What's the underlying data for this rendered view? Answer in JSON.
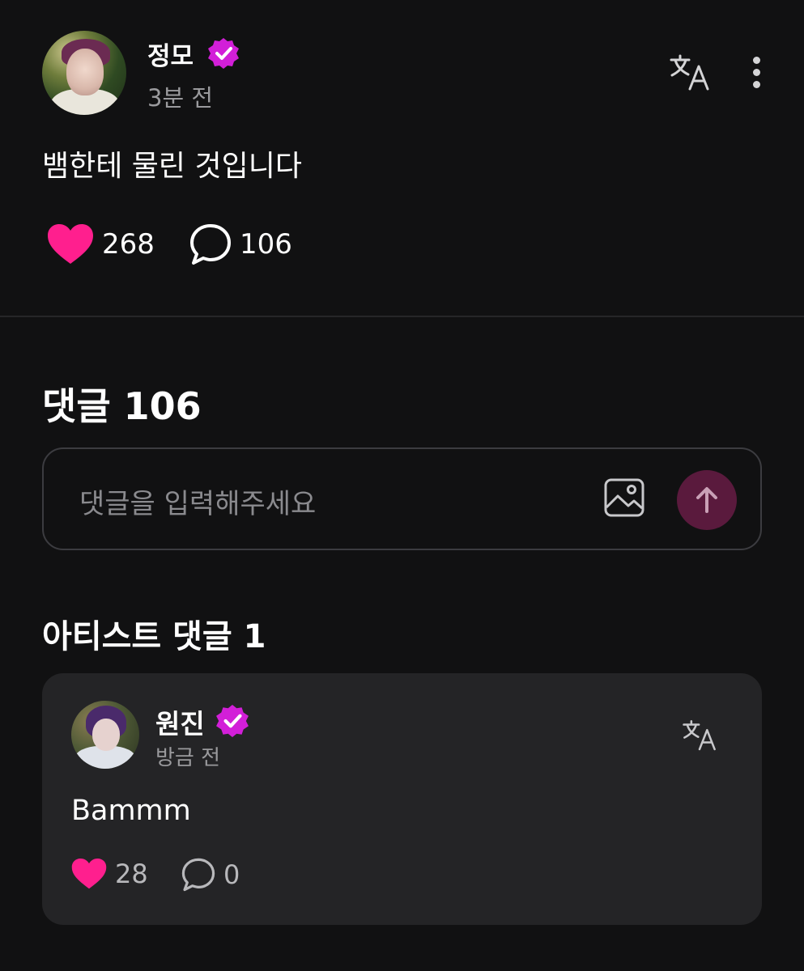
{
  "post": {
    "author": "정모",
    "time": "3분 전",
    "body": "뱀한테 물린 것입니다",
    "likes": "268",
    "comments": "106"
  },
  "comments_section": {
    "title": "댓글 106",
    "input_placeholder": "댓글을 입력해주세요"
  },
  "artist_comments": {
    "title": "아티스트 댓글 1",
    "items": [
      {
        "author": "원진",
        "time": "방금 전",
        "body": "Bammm",
        "likes": "28",
        "replies": "0"
      }
    ]
  },
  "colors": {
    "background": "#111112",
    "card": "#242426",
    "heart": "#ff1f8e",
    "verified": "#d21fd8",
    "send_button": "#5a1a3d"
  },
  "icons": [
    "translate-icon",
    "more-vertical-icon",
    "heart-icon",
    "comment-bubble-icon",
    "image-icon",
    "arrow-up-icon",
    "verified-badge-icon"
  ]
}
